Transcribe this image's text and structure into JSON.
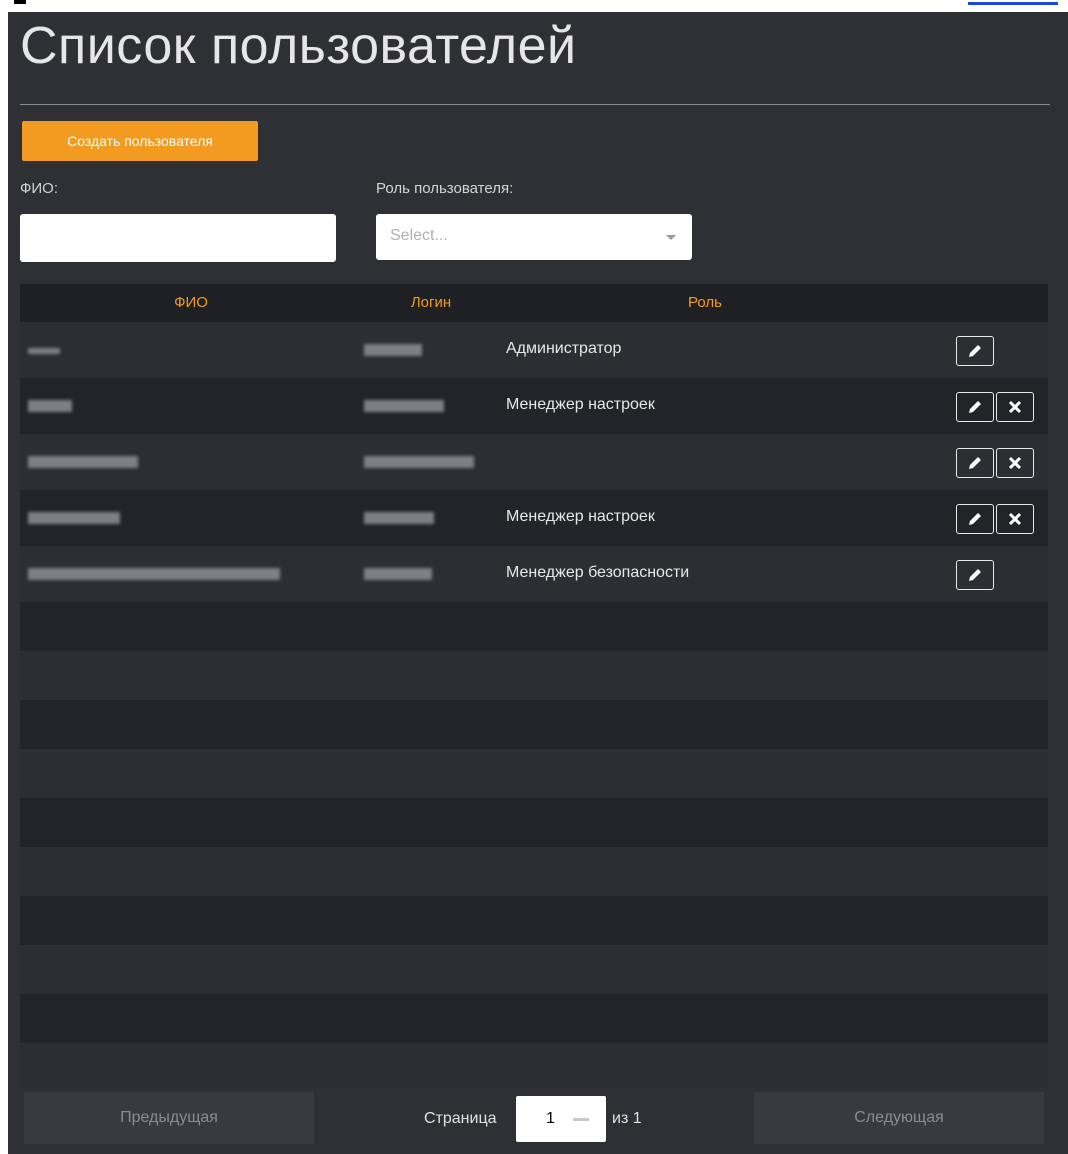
{
  "page": {
    "title": "Список пользователей",
    "create_button": "Создать пользователя"
  },
  "filters": {
    "fio_label": "ФИО:",
    "fio_value": "",
    "role_label": "Роль пользователя:",
    "role_placeholder": "Select..."
  },
  "table": {
    "headers": {
      "fio": "ФИО",
      "login": "Логин",
      "role": "Роль"
    },
    "rows": [
      {
        "role": "Администратор",
        "deletable": false
      },
      {
        "role": "Менеджер настроек",
        "deletable": true
      },
      {
        "role": "",
        "deletable": true
      },
      {
        "role": "Менеджер настроек",
        "deletable": true
      },
      {
        "role": "Менеджер безопасности",
        "deletable": false
      }
    ]
  },
  "pagination": {
    "prev": "Предыдущая",
    "page_label": "Страница",
    "current_page": "1",
    "of_label": "из 1",
    "next": "Следующая"
  },
  "colors": {
    "accent": "#f39a21",
    "background": "#2e3034",
    "header_bg": "#1f2023"
  },
  "icons": {
    "edit": "pencil-icon",
    "delete": "close-icon",
    "select_caret": "chevron-down-icon"
  }
}
